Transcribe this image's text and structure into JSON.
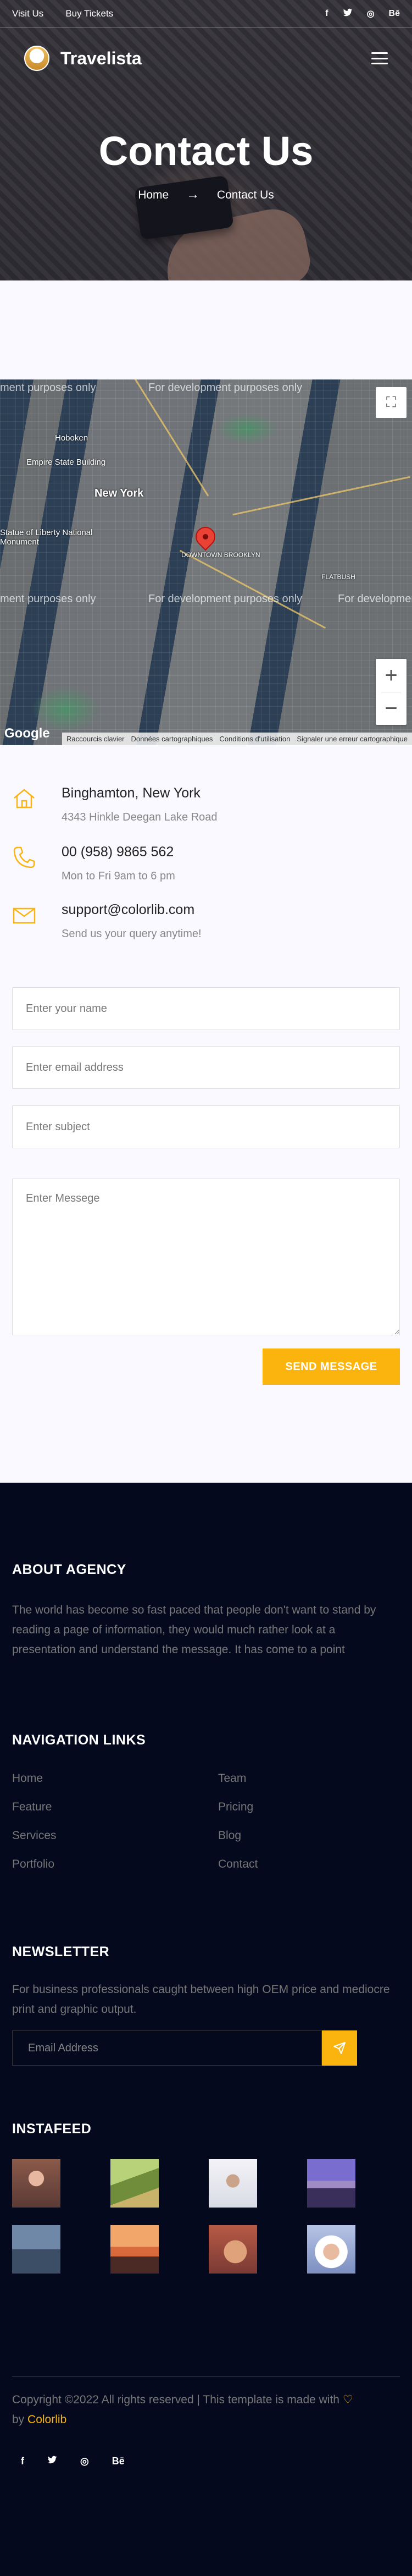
{
  "topbar": {
    "links": [
      "Visit Us",
      "Buy Tickets"
    ],
    "social": [
      "f",
      "t",
      "◎",
      "Bē"
    ]
  },
  "brand": {
    "name": "Travelista"
  },
  "banner": {
    "title": "Contact Us",
    "breadcrumb": {
      "home": "Home",
      "current": "Contact Us"
    }
  },
  "map": {
    "dev_text": "For development purposes only",
    "dev_text_cut": "ment purposes only",
    "places": {
      "new_york": "New York",
      "hoboken": "Hoboken",
      "empire": "Empire State Building",
      "statue": "Statue of Liberty National Monument",
      "brooklyn": "BROOKLYN",
      "downtown": "DOWNTOWN BROOKLYN",
      "flatbush": "FLATBUSH"
    },
    "google": "Google",
    "attribution": [
      "Raccourcis clavier",
      "Données cartographiques",
      "Conditions d'utilisation",
      "Signaler une erreur cartographique"
    ]
  },
  "contact_info": [
    {
      "icon": "home-icon",
      "line1": "Binghamton, New York",
      "line2": "4343 Hinkle Deegan Lake Road"
    },
    {
      "icon": "phone-icon",
      "line1": "00 (958) 9865 562",
      "line2": "Mon to Fri 9am to 6 pm"
    },
    {
      "icon": "envelope-icon",
      "line1": "support@colorlib.com",
      "line2": "Send us your query anytime!"
    }
  ],
  "form": {
    "name_placeholder": "Enter your name",
    "email_placeholder": "Enter email address",
    "subject_placeholder": "Enter subject",
    "message_placeholder": "Enter Messege",
    "send_label": "SEND MESSAGE"
  },
  "footer": {
    "about_heading": "ABOUT AGENCY",
    "about_text": "The world has become so fast paced that people don't want to stand by reading a page of information, they would much rather look at a presentation and understand the message. It has come to a point",
    "nav_heading": "NAVIGATION LINKS",
    "nav_left": [
      "Home",
      "Feature",
      "Services",
      "Portfolio"
    ],
    "nav_right": [
      "Team",
      "Pricing",
      "Blog",
      "Contact"
    ],
    "newsletter_heading": "NEWSLETTER",
    "newsletter_text": "For business professionals caught between high OEM price and mediocre print and graphic output.",
    "newsletter_placeholder": "Email Address",
    "instafeed_heading": "INSTAFEED",
    "copyright_text": "Copyright ©2022 All rights reserved | This template is made with",
    "copyright_by": "by",
    "copyright_brand": "Colorlib",
    "social": [
      "f",
      "t",
      "◎",
      "Bē"
    ]
  },
  "colors": {
    "accent": "#fbb30e",
    "footer_bg": "#04091e",
    "page_bg": "#f9f9ff"
  }
}
